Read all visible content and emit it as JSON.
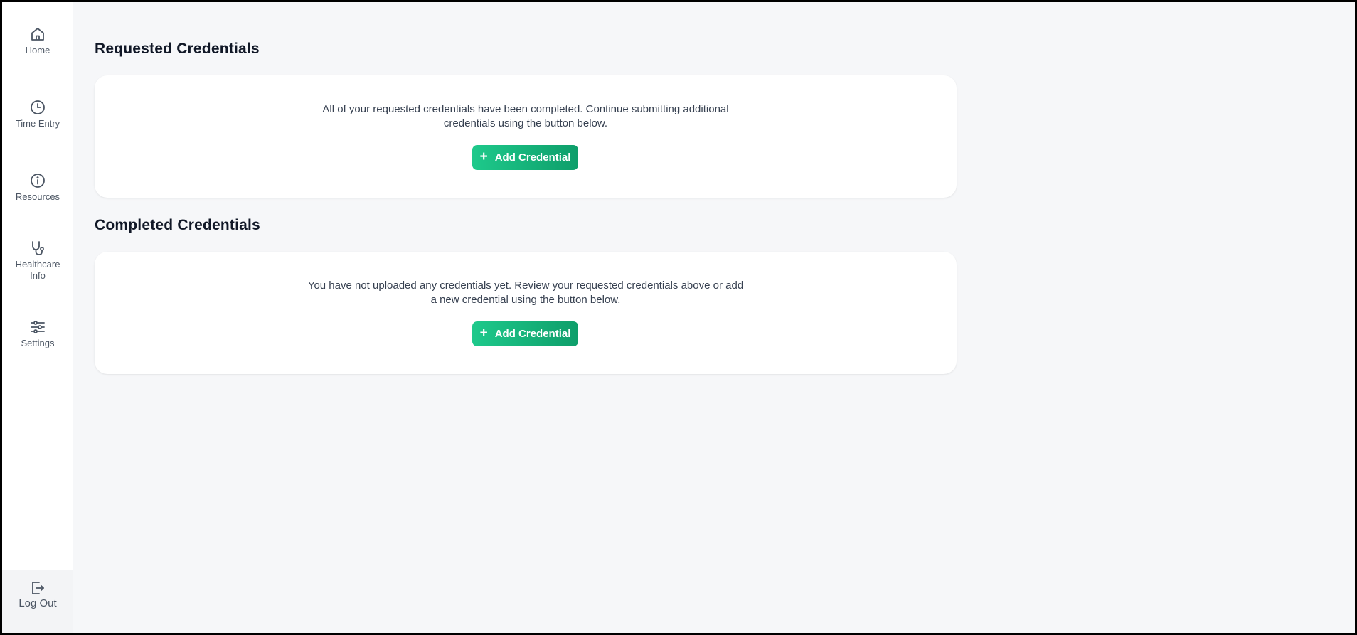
{
  "sidebar": {
    "items": [
      {
        "label": "Home",
        "icon": "home-icon"
      },
      {
        "label": "Time Entry",
        "icon": "clock-icon"
      },
      {
        "label": "Resources",
        "icon": "info-icon"
      },
      {
        "label": "Healthcare Info",
        "icon": "stethoscope-icon"
      },
      {
        "label": "Settings",
        "icon": "sliders-icon"
      }
    ],
    "logout": {
      "label": "Log Out",
      "icon": "logout-icon"
    }
  },
  "requested": {
    "title": "Requested Credentials",
    "message_line1": "All of your requested credentials have been completed. Continue submitting additional",
    "message_line2": "credentials using the button below.",
    "button_label": "Add Credential"
  },
  "completed": {
    "title": "Completed Credentials",
    "message_line1": "You have not uploaded any credentials yet. Review your requested credentials above or add",
    "message_line2": "a new credential using the button below.",
    "button_label": "Add Credential"
  },
  "colors": {
    "accent_start": "#1ec98b",
    "accent_end": "#0e9e6a",
    "background": "#f6f7f9",
    "icon_stroke": "#4b5563"
  },
  "plus_glyph": "+"
}
